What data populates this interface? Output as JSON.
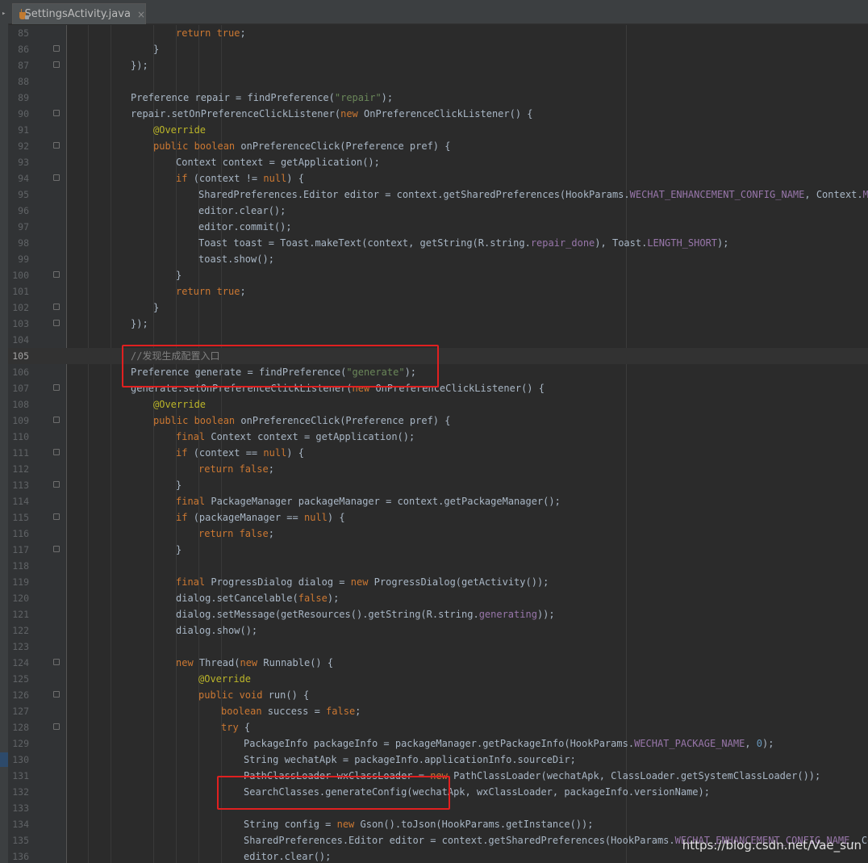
{
  "tab": {
    "title": "SettingsActivity.java",
    "close": "×",
    "icon": "java-file-icon"
  },
  "watermark": "https://blog.csdn.net/Vae_sun",
  "colors": {
    "background": "#2b2b2b",
    "gutter": "#313335",
    "keyword": "#cc7832",
    "string": "#6a8759",
    "annotation": "#bbb529",
    "comment": "#808080",
    "constant": "#9876aa",
    "number": "#6897bb",
    "plain": "#a9b7c6",
    "callout": "#e02020"
  },
  "current_line": 105,
  "lines": [
    {
      "n": "85",
      "indent": 2,
      "fold": false,
      "tokens": [
        [
          "kw",
          "return "
        ],
        [
          "kw",
          "true"
        ],
        [
          "p",
          ";"
        ]
      ]
    },
    {
      "n": "86",
      "indent": 1,
      "fold": true,
      "tokens": [
        [
          "p",
          "}"
        ]
      ]
    },
    {
      "n": "87",
      "indent": 0,
      "fold": true,
      "tokens": [
        [
          "p",
          "});"
        ]
      ]
    },
    {
      "n": "88",
      "indent": 0,
      "fold": false,
      "tokens": []
    },
    {
      "n": "89",
      "indent": 0,
      "fold": false,
      "tokens": [
        [
          "p",
          "Preference repair = findPreference("
        ],
        [
          "str",
          "\"repair\""
        ],
        [
          "p",
          ");"
        ]
      ]
    },
    {
      "n": "90",
      "indent": 0,
      "fold": true,
      "tokens": [
        [
          "p",
          "repair.setOnPreferenceClickListener("
        ],
        [
          "kw",
          "new "
        ],
        [
          "p",
          "OnPreferenceClickListener() {"
        ]
      ]
    },
    {
      "n": "91",
      "indent": 1,
      "fold": false,
      "tokens": [
        [
          "ann",
          "@Override"
        ]
      ]
    },
    {
      "n": "92",
      "indent": 1,
      "fold": true,
      "tokens": [
        [
          "kw",
          "public boolean "
        ],
        [
          "p",
          "onPreferenceClick(Preference pref) {"
        ]
      ]
    },
    {
      "n": "93",
      "indent": 2,
      "fold": false,
      "tokens": [
        [
          "p",
          "Context context = getApplication();"
        ]
      ]
    },
    {
      "n": "94",
      "indent": 2,
      "fold": true,
      "tokens": [
        [
          "kw",
          "if "
        ],
        [
          "p",
          "(context != "
        ],
        [
          "kw",
          "null"
        ],
        [
          "p",
          ") {"
        ]
      ]
    },
    {
      "n": "95",
      "indent": 3,
      "fold": false,
      "tokens": [
        [
          "p",
          "SharedPreferences.Editor editor = context.getSharedPreferences(HookParams."
        ],
        [
          "c",
          "WECHAT_ENHANCEMENT_CONFIG_NAME"
        ],
        [
          "p",
          ", Context."
        ],
        [
          "c",
          "MODE_WORLD_READABLE"
        ],
        [
          "p",
          ").edit();"
        ]
      ]
    },
    {
      "n": "96",
      "indent": 3,
      "fold": false,
      "tokens": [
        [
          "p",
          "editor.clear();"
        ]
      ]
    },
    {
      "n": "97",
      "indent": 3,
      "fold": false,
      "tokens": [
        [
          "p",
          "editor.commit();"
        ]
      ]
    },
    {
      "n": "98",
      "indent": 3,
      "fold": false,
      "tokens": [
        [
          "p",
          "Toast toast = Toast.makeText(context, getString(R.string."
        ],
        [
          "c",
          "repair_done"
        ],
        [
          "p",
          "), Toast."
        ],
        [
          "c",
          "LENGTH_SHORT"
        ],
        [
          "p",
          ");"
        ]
      ]
    },
    {
      "n": "99",
      "indent": 3,
      "fold": false,
      "tokens": [
        [
          "p",
          "toast.show();"
        ]
      ]
    },
    {
      "n": "100",
      "indent": 2,
      "fold": true,
      "tokens": [
        [
          "p",
          "}"
        ]
      ]
    },
    {
      "n": "101",
      "indent": 2,
      "fold": false,
      "tokens": [
        [
          "kw",
          "return "
        ],
        [
          "kw",
          "true"
        ],
        [
          "p",
          ";"
        ]
      ]
    },
    {
      "n": "102",
      "indent": 1,
      "fold": true,
      "tokens": [
        [
          "p",
          "}"
        ]
      ]
    },
    {
      "n": "103",
      "indent": 0,
      "fold": true,
      "tokens": [
        [
          "p",
          "});"
        ]
      ]
    },
    {
      "n": "104",
      "indent": 0,
      "fold": false,
      "tokens": []
    },
    {
      "n": "105",
      "indent": 0,
      "fold": false,
      "tokens": [
        [
          "com",
          "//发现生成配置入口"
        ]
      ]
    },
    {
      "n": "106",
      "indent": 0,
      "fold": false,
      "tokens": [
        [
          "p",
          "Preference generate = findPreference("
        ],
        [
          "str",
          "\"generate\""
        ],
        [
          "p",
          ");"
        ]
      ]
    },
    {
      "n": "107",
      "indent": 0,
      "fold": true,
      "tokens": [
        [
          "p",
          "generate.setOnPreferenceClickListener("
        ],
        [
          "kw",
          "new "
        ],
        [
          "p",
          "OnPreferenceClickListener() {"
        ]
      ]
    },
    {
      "n": "108",
      "indent": 1,
      "fold": false,
      "tokens": [
        [
          "ann",
          "@Override"
        ]
      ]
    },
    {
      "n": "109",
      "indent": 1,
      "fold": true,
      "tokens": [
        [
          "kw",
          "public boolean "
        ],
        [
          "p",
          "onPreferenceClick(Preference pref) {"
        ]
      ]
    },
    {
      "n": "110",
      "indent": 2,
      "fold": false,
      "tokens": [
        [
          "kw",
          "final "
        ],
        [
          "p",
          "Context context = getApplication();"
        ]
      ]
    },
    {
      "n": "111",
      "indent": 2,
      "fold": true,
      "tokens": [
        [
          "kw",
          "if "
        ],
        [
          "p",
          "(context == "
        ],
        [
          "kw",
          "null"
        ],
        [
          "p",
          ") {"
        ]
      ]
    },
    {
      "n": "112",
      "indent": 3,
      "fold": false,
      "tokens": [
        [
          "kw",
          "return "
        ],
        [
          "kw",
          "false"
        ],
        [
          "p",
          ";"
        ]
      ]
    },
    {
      "n": "113",
      "indent": 2,
      "fold": true,
      "tokens": [
        [
          "p",
          "}"
        ]
      ]
    },
    {
      "n": "114",
      "indent": 2,
      "fold": false,
      "tokens": [
        [
          "kw",
          "final "
        ],
        [
          "p",
          "PackageManager packageManager = context.getPackageManager();"
        ]
      ]
    },
    {
      "n": "115",
      "indent": 2,
      "fold": true,
      "tokens": [
        [
          "kw",
          "if "
        ],
        [
          "p",
          "(packageManager == "
        ],
        [
          "kw",
          "null"
        ],
        [
          "p",
          ") {"
        ]
      ]
    },
    {
      "n": "116",
      "indent": 3,
      "fold": false,
      "tokens": [
        [
          "kw",
          "return "
        ],
        [
          "kw",
          "false"
        ],
        [
          "p",
          ";"
        ]
      ]
    },
    {
      "n": "117",
      "indent": 2,
      "fold": true,
      "tokens": [
        [
          "p",
          "}"
        ]
      ]
    },
    {
      "n": "118",
      "indent": 0,
      "fold": false,
      "tokens": []
    },
    {
      "n": "119",
      "indent": 2,
      "fold": false,
      "tokens": [
        [
          "kw",
          "final "
        ],
        [
          "p",
          "ProgressDialog dialog = "
        ],
        [
          "kw",
          "new "
        ],
        [
          "p",
          "ProgressDialog(getActivity());"
        ]
      ]
    },
    {
      "n": "120",
      "indent": 2,
      "fold": false,
      "tokens": [
        [
          "p",
          "dialog.setCancelable("
        ],
        [
          "kw",
          "false"
        ],
        [
          "p",
          ");"
        ]
      ]
    },
    {
      "n": "121",
      "indent": 2,
      "fold": false,
      "tokens": [
        [
          "p",
          "dialog.setMessage(getResources().getString(R.string."
        ],
        [
          "c",
          "generating"
        ],
        [
          "p",
          "));"
        ]
      ]
    },
    {
      "n": "122",
      "indent": 2,
      "fold": false,
      "tokens": [
        [
          "p",
          "dialog.show();"
        ]
      ]
    },
    {
      "n": "123",
      "indent": 0,
      "fold": false,
      "tokens": []
    },
    {
      "n": "124",
      "indent": 2,
      "fold": true,
      "tokens": [
        [
          "kw",
          "new "
        ],
        [
          "p",
          "Thread("
        ],
        [
          "kw",
          "new "
        ],
        [
          "p",
          "Runnable() {"
        ]
      ]
    },
    {
      "n": "125",
      "indent": 3,
      "fold": false,
      "tokens": [
        [
          "ann",
          "@Override"
        ]
      ]
    },
    {
      "n": "126",
      "indent": 3,
      "fold": true,
      "tokens": [
        [
          "kw",
          "public void "
        ],
        [
          "p",
          "run() {"
        ]
      ]
    },
    {
      "n": "127",
      "indent": 4,
      "fold": false,
      "tokens": [
        [
          "kw",
          "boolean "
        ],
        [
          "p",
          "success = "
        ],
        [
          "kw",
          "false"
        ],
        [
          "p",
          ";"
        ]
      ]
    },
    {
      "n": "128",
      "indent": 4,
      "fold": true,
      "tokens": [
        [
          "kw",
          "try "
        ],
        [
          "p",
          "{"
        ]
      ]
    },
    {
      "n": "129",
      "indent": 5,
      "fold": false,
      "tokens": [
        [
          "p",
          "PackageInfo packageInfo = packageManager.getPackageInfo(HookParams."
        ],
        [
          "c",
          "WECHAT_PACKAGE_NAME"
        ],
        [
          "p",
          ", "
        ],
        [
          "num",
          "0"
        ],
        [
          "p",
          ");"
        ]
      ]
    },
    {
      "n": "130",
      "indent": 5,
      "fold": false,
      "tokens": [
        [
          "p",
          "String wechatApk = packageInfo.applicationInfo.sourceDir;"
        ]
      ]
    },
    {
      "n": "131",
      "indent": 5,
      "fold": false,
      "tokens": [
        [
          "p",
          "PathClassLoader wxClassLoader = "
        ],
        [
          "kw",
          "new "
        ],
        [
          "p",
          "PathClassLoader(wechatApk, ClassLoader.getSystemClassLoader());"
        ]
      ]
    },
    {
      "n": "132",
      "indent": 5,
      "fold": false,
      "tokens": [
        [
          "p",
          "SearchClasses.generateConfig(wechatApk, wxClassLoader, packageInfo.versionName);"
        ]
      ]
    },
    {
      "n": "133",
      "indent": 0,
      "fold": false,
      "tokens": []
    },
    {
      "n": "134",
      "indent": 5,
      "fold": false,
      "tokens": [
        [
          "p",
          "String config = "
        ],
        [
          "kw",
          "new "
        ],
        [
          "p",
          "Gson().toJson(HookParams.getInstance());"
        ]
      ]
    },
    {
      "n": "135",
      "indent": 5,
      "fold": false,
      "tokens": [
        [
          "p",
          "SharedPreferences.Editor editor = context.getSharedPreferences(HookParams."
        ],
        [
          "c",
          "WECHAT_ENHANCEMENT_CONFIG_NAME"
        ],
        [
          "p",
          ", Context."
        ],
        [
          "c",
          "MODE_WORLD_READABLE"
        ],
        [
          "p",
          ").edit();"
        ]
      ]
    },
    {
      "n": "136",
      "indent": 5,
      "fold": false,
      "tokens": [
        [
          "p",
          "editor.clear();"
        ]
      ]
    }
  ]
}
